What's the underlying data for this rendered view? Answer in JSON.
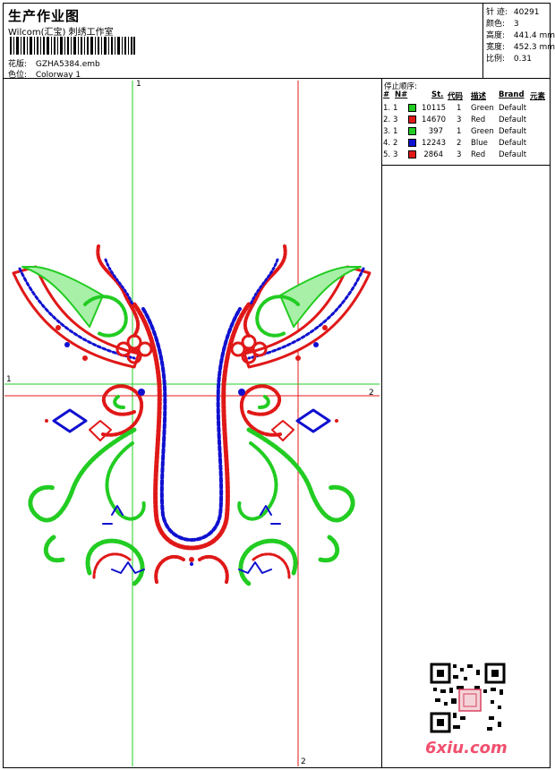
{
  "header": {
    "title": "生产作业图",
    "subtitle": "Wilcom(汇宝) 刺绣工作室",
    "design_label": "花版:",
    "design_value": "GZHA5384.emb",
    "colorway_label": "色位:",
    "colorway_value": "Colorway 1"
  },
  "stats": [
    {
      "label": "针 迹:",
      "value": "40291"
    },
    {
      "label": "颜色:",
      "value": "3"
    },
    {
      "label": "高度:",
      "value": "441.4 mm"
    },
    {
      "label": "宽度:",
      "value": "452.3 mm"
    },
    {
      "label": "比例:",
      "value": "0.31"
    }
  ],
  "stop_sequence": {
    "title": "停止顺序:",
    "headers": [
      "#",
      "N#",
      "St.",
      "代码",
      "描述",
      "Brand",
      "元素"
    ],
    "rows": [
      {
        "idx": "1.",
        "n": "1",
        "color": "#22cc22",
        "st": "10115",
        "code": "1",
        "desc": "Green",
        "brand": "Default"
      },
      {
        "idx": "2.",
        "n": "3",
        "color": "#e01818",
        "st": "14670",
        "code": "3",
        "desc": "Red",
        "brand": "Default"
      },
      {
        "idx": "3.",
        "n": "1",
        "color": "#22cc22",
        "st": "397",
        "code": "1",
        "desc": "Green",
        "brand": "Default"
      },
      {
        "idx": "4.",
        "n": "2",
        "color": "#1010d0",
        "st": "12243",
        "code": "2",
        "desc": "Blue",
        "brand": "Default"
      },
      {
        "idx": "5.",
        "n": "3",
        "color": "#e01818",
        "st": "2864",
        "code": "3",
        "desc": "Red",
        "brand": "Default"
      }
    ]
  },
  "guides": {
    "v1_label": "1",
    "v2_label": "2",
    "h1_label": "1",
    "h2_label": "2"
  },
  "colors": {
    "green": "#22cc22",
    "red": "#e01818",
    "blue": "#1010d0"
  },
  "watermark": "6xiu.com"
}
